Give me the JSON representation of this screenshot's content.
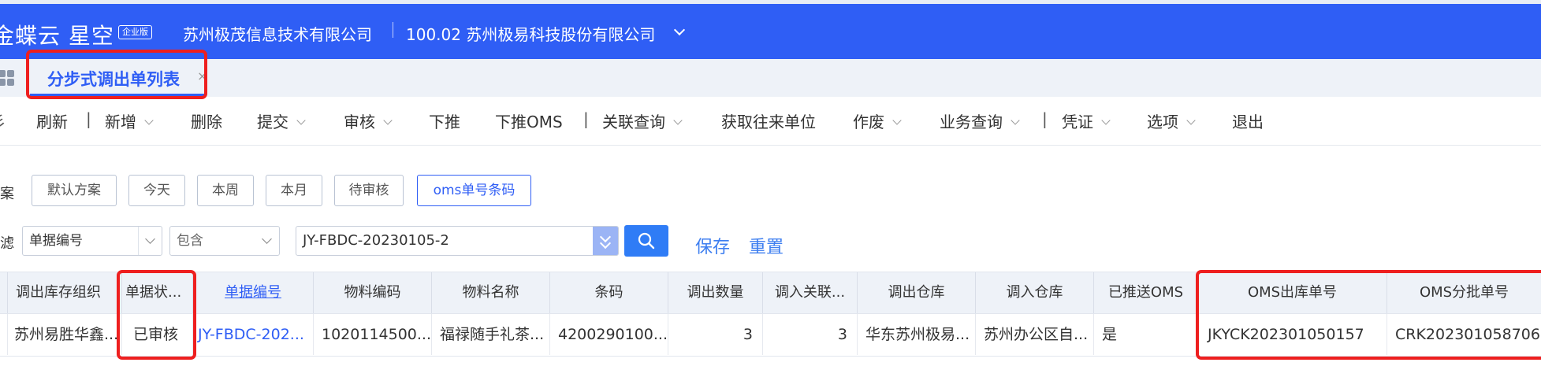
{
  "header": {
    "brand": "金蝶云 星空",
    "edition_badge": "企业版",
    "company": "苏州极茂信息技术有限公司",
    "org": "100.02 苏州极易科技股份有限公司",
    "colors": {
      "bar": "#2f5ef5",
      "highlight": "#ee1f1f"
    }
  },
  "tabs": [
    {
      "label": "分步式调出单列表",
      "active": true
    }
  ],
  "toolbar": {
    "items": [
      {
        "label": "刷新",
        "dropdown": false
      },
      {
        "label": "新增",
        "dropdown": true
      },
      {
        "label": "删除",
        "dropdown": false
      },
      {
        "label": "提交",
        "dropdown": true
      },
      {
        "label": "审核",
        "dropdown": true
      },
      {
        "label": "下推",
        "dropdown": false
      },
      {
        "label": "下推OMS",
        "dropdown": false
      },
      {
        "label": "关联查询",
        "dropdown": true
      },
      {
        "label": "获取往来单位",
        "dropdown": false
      },
      {
        "label": "作废",
        "dropdown": true
      },
      {
        "label": "业务查询",
        "dropdown": true
      },
      {
        "label": "凭证",
        "dropdown": true
      },
      {
        "label": "选项",
        "dropdown": true
      },
      {
        "label": "退出",
        "dropdown": false
      }
    ]
  },
  "scheme": {
    "label": "案",
    "chips": [
      "默认方案",
      "今天",
      "本周",
      "本月",
      "待审核",
      "oms单号条码"
    ],
    "active": "oms单号条码"
  },
  "filter": {
    "label": "滤",
    "field": "单据编号",
    "operator": "包含",
    "value": "JY-FBDC-20230105-2",
    "save_label": "保存",
    "reset_label": "重置"
  },
  "grid": {
    "columns": [
      "调出库存组织",
      "单据状...",
      "单据编号",
      "物料编码",
      "物料名称",
      "条码",
      "调出数量",
      "调入关联...",
      "调出仓库",
      "调入仓库",
      "已推送OMS",
      "OMS出库单号",
      "OMS分批单号"
    ],
    "rows": [
      [
        "苏州易胜华鑫...",
        "已审核",
        "JY-FBDC-202...",
        "1020114500...",
        "福禄随手礼茶...",
        "4200290100...",
        "3",
        "3",
        "华东苏州极易...",
        "苏州办公区自...",
        "是",
        "JKYCK202301050157",
        "CRK202301058706"
      ]
    ]
  }
}
